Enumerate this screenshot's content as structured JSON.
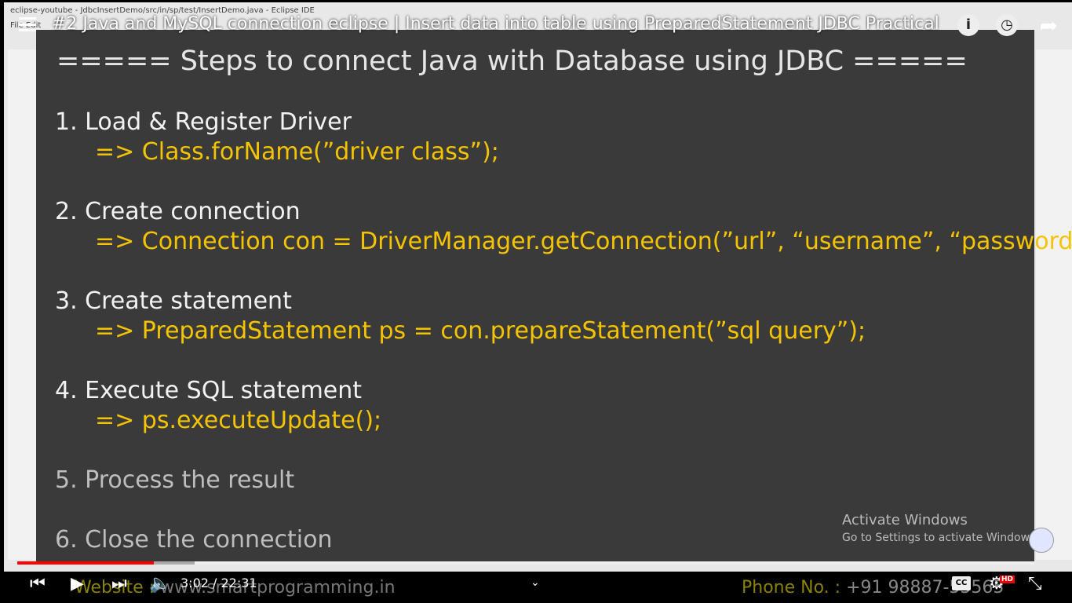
{
  "eclipse": {
    "window_title": "eclipse-youtube - JdbcInsertDemo/src/in/sp/test/InsertDemo.java - Eclipse IDE",
    "menu": "File  Edit"
  },
  "video": {
    "title": "#2 Java and MySQL connection eclipse | Insert data into table using PreparedStatement JDBC Practical",
    "time": "3:02 / 22:31",
    "progress_percent": 13.4,
    "buffered_percent": 17.4
  },
  "slide": {
    "heading": "===== Steps to connect Java with Database using JDBC =====",
    "steps": [
      {
        "label": "1. Load & Register Driver",
        "code": "=> Class.forName(”driver class”);"
      },
      {
        "label": "2. Create connection",
        "code": "=> Connection con = DriverManager.getConnection(”url”, “username”, “password”);"
      },
      {
        "label": "3. Create statement",
        "code": "=> PreparedStatement ps = con.prepareStatement(”sql query”);"
      },
      {
        "label": "4. Execute SQL statement",
        "code": "=> ps.executeUpdate();"
      },
      {
        "label": "5. Process the result"
      },
      {
        "label": "6. Close the connection"
      }
    ],
    "website_label": "Website :",
    "website": "www.smartprogramming.in",
    "phone_label": "Phone No. :",
    "phone": "+91 98887-55565"
  },
  "watermark": {
    "title": "Activate Windows",
    "subtitle": "Go to Settings to activate Windows."
  },
  "controls": {
    "cc": "CC",
    "hd": "HD"
  }
}
